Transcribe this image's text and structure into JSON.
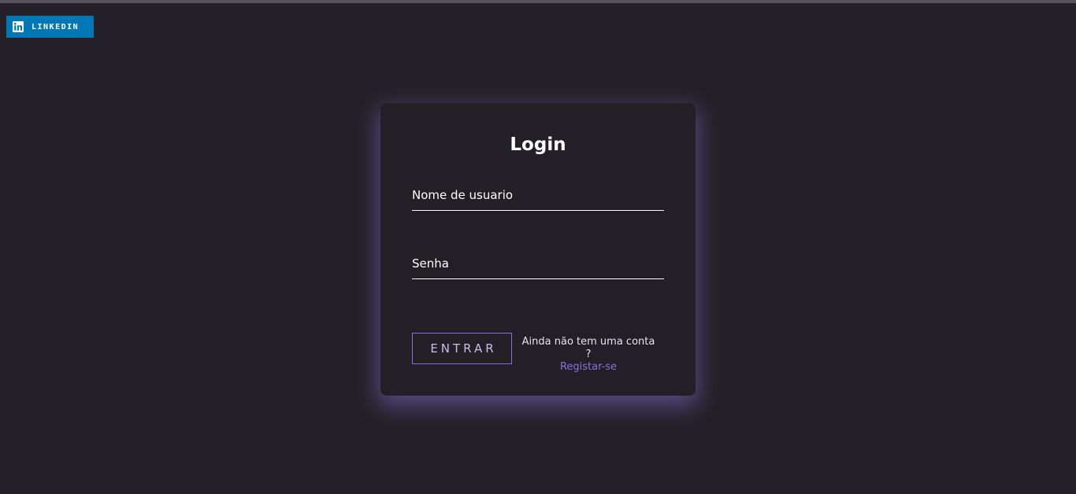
{
  "linkedin": {
    "label": "LINKEDIN",
    "icon": "linkedin-icon",
    "color": "#0077b5"
  },
  "login": {
    "title": "Login",
    "username": {
      "label": "Nome de usuario",
      "value": ""
    },
    "password": {
      "label": "Senha",
      "value": ""
    },
    "submit_label": "ENTRAR",
    "register_question": "Ainda não tem uma conta ?",
    "register_link": "Registar-se"
  },
  "colors": {
    "background": "#242027",
    "card": "#231f26",
    "accent": "#8b6fe0",
    "glow": "#8067c7"
  }
}
